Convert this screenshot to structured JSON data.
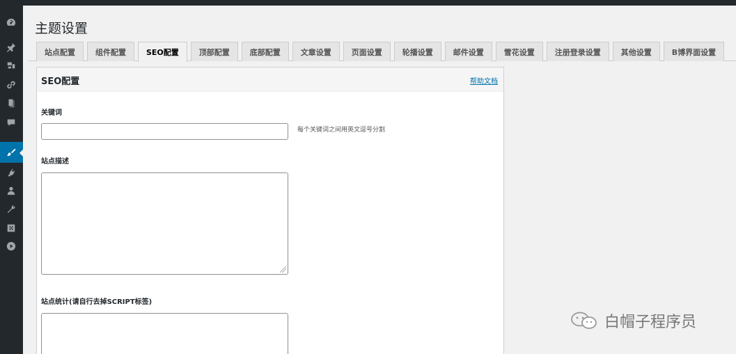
{
  "page": {
    "title": "主题设置"
  },
  "tabs": [
    {
      "label": "站点配置",
      "active": false
    },
    {
      "label": "组件配置",
      "active": false
    },
    {
      "label": "SEO配置",
      "active": true
    },
    {
      "label": "顶部配置",
      "active": false
    },
    {
      "label": "底部配置",
      "active": false
    },
    {
      "label": "文章设置",
      "active": false
    },
    {
      "label": "页面设置",
      "active": false
    },
    {
      "label": "轮播设置",
      "active": false
    },
    {
      "label": "邮件设置",
      "active": false
    },
    {
      "label": "雪花设置",
      "active": false
    },
    {
      "label": "注册登录设置",
      "active": false
    },
    {
      "label": "其他设置",
      "active": false
    },
    {
      "label": "B博界面设置",
      "active": false
    }
  ],
  "panel": {
    "title": "SEO配置",
    "help_link": "帮助文档",
    "fields": {
      "keywords": {
        "label": "关键词",
        "value": "",
        "hint": "每个关键词之间用英文逗号分割"
      },
      "description": {
        "label": "站点描述",
        "value": ""
      },
      "stats": {
        "label": "站点统计(请自行去掉SCRIPT标签)",
        "value": ""
      }
    }
  },
  "sidebar": {
    "icons": [
      "dashboard-icon",
      "pin-icon",
      "media-icon",
      "link-icon",
      "pages-icon",
      "comments-icon",
      "appearance-icon",
      "plugins-icon",
      "users-icon",
      "tools-icon",
      "settings-icon",
      "play-icon"
    ],
    "active": "appearance-icon",
    "accent_color": "#0073aa"
  },
  "watermark": {
    "text": "白帽子程序员"
  }
}
